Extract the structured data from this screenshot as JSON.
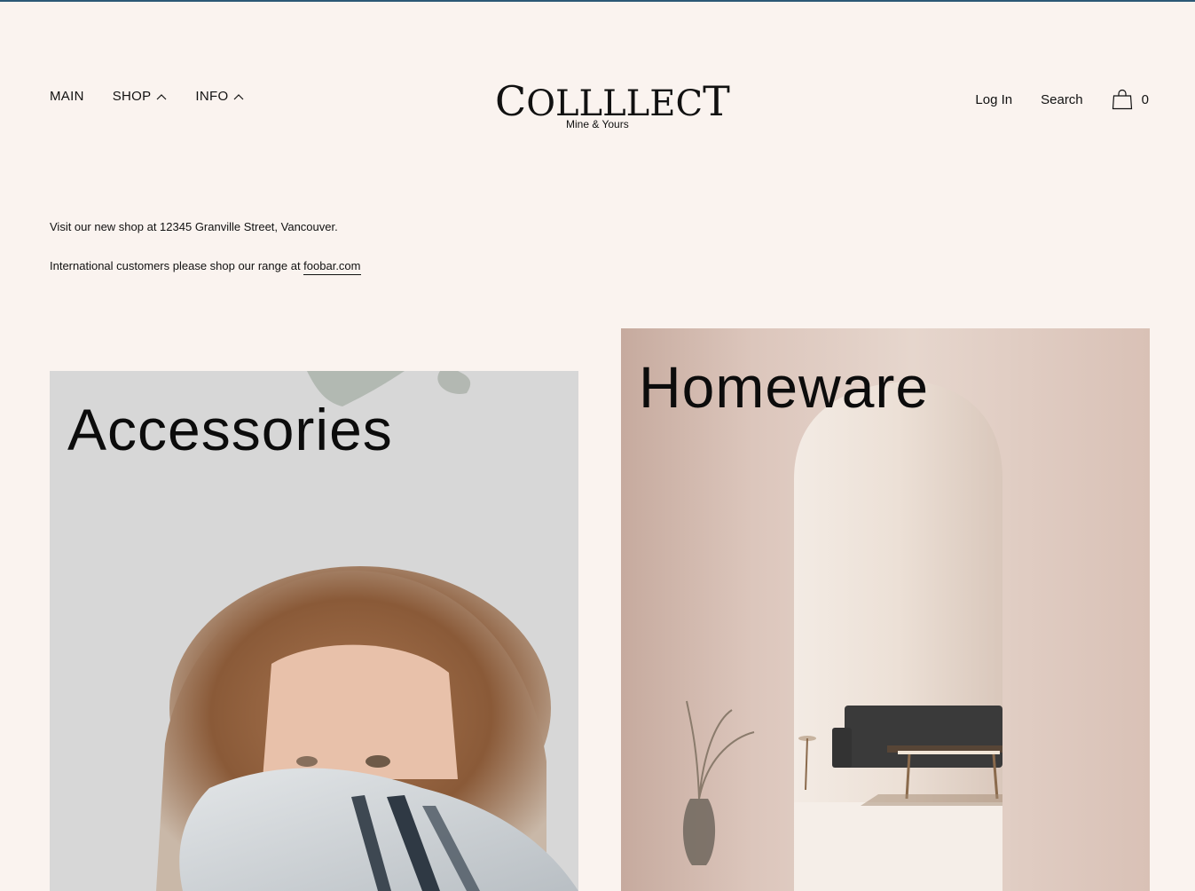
{
  "header": {
    "nav_left": [
      {
        "label": "MAIN"
      },
      {
        "label": "SHOP"
      },
      {
        "label": "INFO"
      }
    ],
    "logo": {
      "wordmark_big1": "C",
      "wordmark_mid": "OLLLLEC",
      "wordmark_big2": "T",
      "tagline": "Mine & Yours"
    },
    "nav_right": {
      "login": "Log In",
      "search": "Search",
      "cart_count": "0"
    }
  },
  "notices": {
    "line1": "Visit our new shop at 12345 Granville Street, Vancouver.",
    "line2_prefix": "International customers please shop our range at ",
    "line2_link": "foobar.com"
  },
  "categories": [
    {
      "title": "Accessories"
    },
    {
      "title": "Homeware"
    }
  ],
  "colors": {
    "background": "#faf3ef",
    "top_border": "#2b5876"
  }
}
